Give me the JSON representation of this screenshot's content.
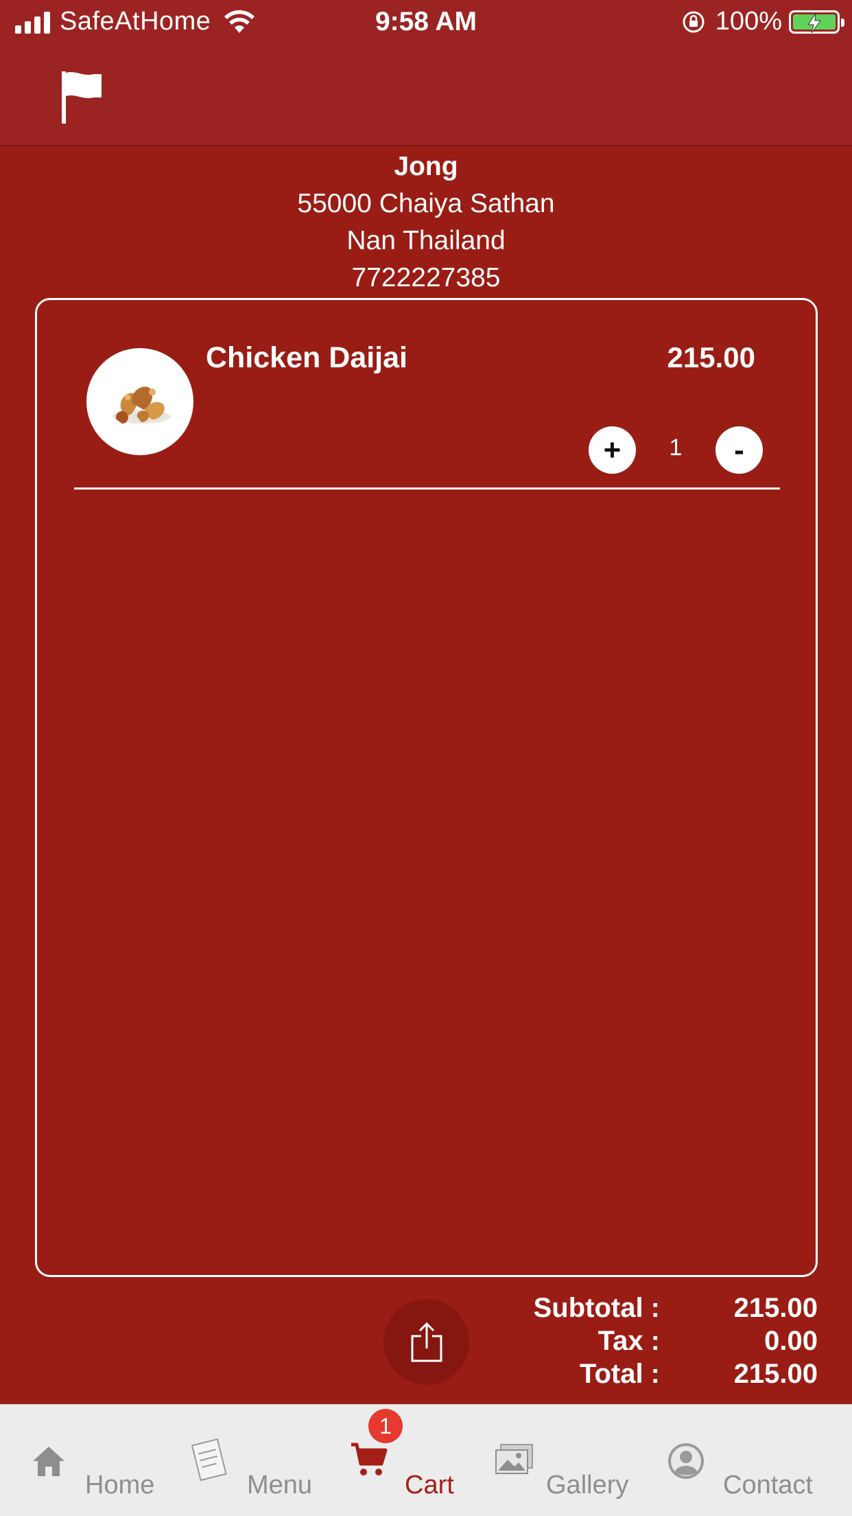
{
  "status_bar": {
    "carrier": "SafeAtHome",
    "time": "9:58 AM",
    "battery_percent": "100%"
  },
  "nav_bar": {
    "flag_icon": "flag-icon"
  },
  "address": {
    "name": "Jong",
    "line1": "55000 Chaiya Sathan",
    "line2": "Nan Thailand",
    "phone": "7722227385"
  },
  "cart": {
    "items": [
      {
        "name": "Chicken Daijai",
        "price": "215.00",
        "quantity": "1",
        "plus_label": "+",
        "minus_label": "-"
      }
    ]
  },
  "totals": {
    "subtotal_label": "Subtotal :",
    "subtotal_value": "215.00",
    "tax_label": "Tax :",
    "tax_value": "0.00",
    "total_label": "Total :",
    "total_value": "215.00"
  },
  "tab_bar": {
    "tabs": [
      {
        "label": "Home",
        "icon": "home-icon"
      },
      {
        "label": "Menu",
        "icon": "menu-icon"
      },
      {
        "label": "Cart",
        "icon": "cart-icon"
      },
      {
        "label": "Gallery",
        "icon": "gallery-icon"
      },
      {
        "label": "Contact",
        "icon": "contact-icon"
      }
    ],
    "active_tab": "Cart",
    "cart_badge": "1"
  },
  "colors": {
    "background": "#991d15",
    "header": "#9b2422",
    "active_tab": "#a51f18",
    "badge": "#e6392f"
  }
}
